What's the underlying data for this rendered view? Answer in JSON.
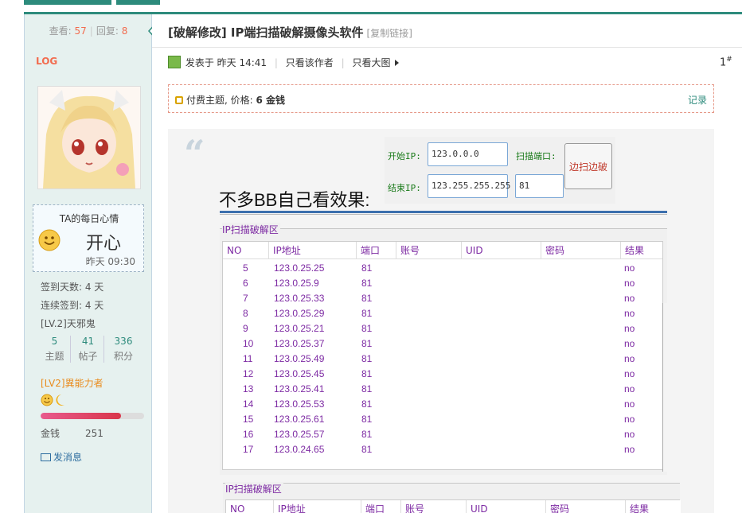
{
  "colors": {
    "accent": "#2d8b7c",
    "sidebar_bg": "#e6f1ef",
    "list_text": "#7d2aa3",
    "form_label": "#197a19"
  },
  "sidebar": {
    "views_label": "查看:",
    "views": "57",
    "replies_label": "回复:",
    "replies": "8",
    "log": "LOG",
    "mood": {
      "title": "TA的每日心情",
      "text": "开心",
      "time": "昨天 09:30",
      "icon": "smile-face-icon"
    },
    "checkin_days": "签到天数: 4 天",
    "streak": "连续签到: 4 天",
    "level": "[LV.2]天邪鬼",
    "counts": [
      {
        "value": "5",
        "label": "主题"
      },
      {
        "value": "41",
        "label": "帖子"
      },
      {
        "value": "336",
        "label": "积分"
      }
    ],
    "medal_level": "[LV2]異能力者",
    "progress_fraction": 0.78,
    "money_label": "金钱",
    "money": "251",
    "send_pm": "发消息"
  },
  "post": {
    "title": "[破解修改] IP端扫描破解摄像头软件",
    "copy_link": "[复制链接]",
    "posted": "发表于 昨天 14:41",
    "only_author": "只看该作者",
    "big_image": "只看大图",
    "floor": "1",
    "floor_mark": "#",
    "paid_text": "付费主题, 价格: ",
    "paid_price": "6 金钱",
    "paid_record": "记录",
    "quote_mark": "“",
    "body_text": "不多BB自己看效果:"
  },
  "scanner": {
    "start_ip_label": "开始IP:",
    "start_ip": "123.0.0.0",
    "end_ip_label": "结束IP:",
    "end_ip": "123.255.255.255",
    "port_label": "扫描端口:",
    "port": "81",
    "scan_button": "边扫边破",
    "group_title": "IP扫描破解区",
    "columns": [
      "NO",
      "IP地址",
      "端口",
      "账号",
      "UID",
      "密码",
      "结果"
    ],
    "rows": [
      [
        "5",
        "123.0.25.25",
        "81",
        "",
        "",
        "",
        "no"
      ],
      [
        "6",
        "123.0.25.9",
        "81",
        "",
        "",
        "",
        "no"
      ],
      [
        "7",
        "123.0.25.33",
        "81",
        "",
        "",
        "",
        "no"
      ],
      [
        "8",
        "123.0.25.29",
        "81",
        "",
        "",
        "",
        "no"
      ],
      [
        "9",
        "123.0.25.21",
        "81",
        "",
        "",
        "",
        "no"
      ],
      [
        "10",
        "123.0.25.37",
        "81",
        "",
        "",
        "",
        "no"
      ],
      [
        "11",
        "123.0.25.49",
        "81",
        "",
        "",
        "",
        "no"
      ],
      [
        "12",
        "123.0.25.45",
        "81",
        "",
        "",
        "",
        "no"
      ],
      [
        "13",
        "123.0.25.41",
        "81",
        "",
        "",
        "",
        "no"
      ],
      [
        "14",
        "123.0.25.53",
        "81",
        "",
        "",
        "",
        "no"
      ],
      [
        "15",
        "123.0.25.61",
        "81",
        "",
        "",
        "",
        "no"
      ],
      [
        "16",
        "123.0.25.57",
        "81",
        "",
        "",
        "",
        "no"
      ],
      [
        "17",
        "123.0.24.65",
        "81",
        "",
        "",
        "",
        "no"
      ]
    ],
    "group_title_2": "IP扫描破解区",
    "columns_2": [
      "NO",
      "IP地址",
      "端口",
      "账号",
      "UID",
      "密码",
      "结果"
    ]
  }
}
